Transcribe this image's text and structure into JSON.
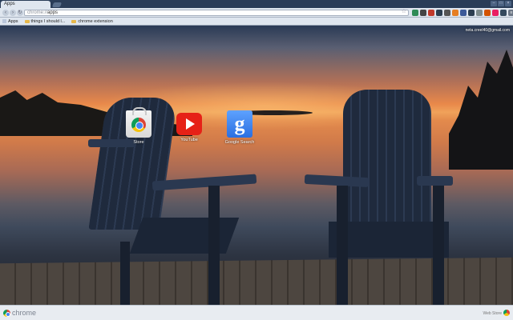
{
  "tabs": [
    {
      "title": "Apps"
    }
  ],
  "window_controls": [
    "–",
    "□",
    "×"
  ],
  "omnibox": {
    "scheme": "chrome://",
    "path": "apps"
  },
  "bookmarks": [
    {
      "label": "Apps",
      "icon": "apps-grid-icon"
    },
    {
      "label": "things I should l...",
      "icon": "folder-icon"
    },
    {
      "label": "chrome extension",
      "icon": "folder-icon"
    }
  ],
  "extensions": [
    {
      "icon": "extension-icon",
      "color": "#2e8b57"
    },
    {
      "icon": "extension-icon",
      "color": "#444444"
    },
    {
      "icon": "extension-icon",
      "color": "#c0392b"
    },
    {
      "icon": "extension-icon",
      "color": "#2c3e50"
    },
    {
      "icon": "extension-icon",
      "color": "#555555"
    },
    {
      "icon": "extension-icon",
      "color": "#e67e22"
    },
    {
      "icon": "extension-icon",
      "color": "#3b5998"
    },
    {
      "icon": "extension-icon",
      "color": "#2c3e50"
    },
    {
      "icon": "extension-icon",
      "color": "#7f8c8d"
    },
    {
      "icon": "extension-icon",
      "color": "#d35400"
    },
    {
      "icon": "extension-icon",
      "color": "#e91e63"
    },
    {
      "icon": "extension-icon",
      "color": "#34495e"
    },
    {
      "icon": "menu-icon",
      "color": "#6b7685"
    }
  ],
  "account": "neta.creel40@gmail.com",
  "apps": [
    {
      "label": "Store"
    },
    {
      "label": "YouTube"
    },
    {
      "label": "Google Search"
    }
  ],
  "bottom": {
    "brand": "chrome",
    "webstore": "Web Store"
  }
}
